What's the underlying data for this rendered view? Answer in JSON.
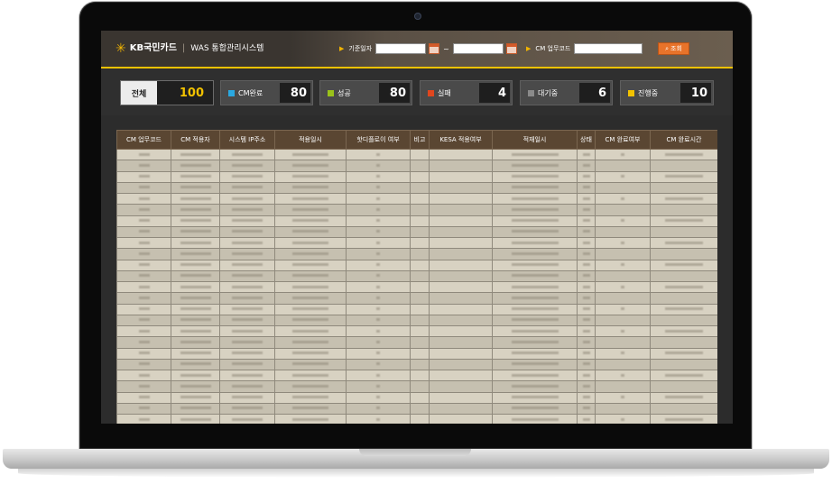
{
  "app": {
    "brand": "KB국민카드",
    "system_title": "WAS 통합관리시스템"
  },
  "filters": {
    "base_date_label": "기준일자",
    "cm_code_label": "CM 업무코드",
    "range_separator": "~",
    "search_label": "조회"
  },
  "summary": [
    {
      "label": "전체",
      "value": "100",
      "color": "#f2c200"
    },
    {
      "label": "CM완료",
      "value": "80",
      "color": "#2aa8e0"
    },
    {
      "label": "성공",
      "value": "80",
      "color": "#9ac21a"
    },
    {
      "label": "실패",
      "value": "4",
      "color": "#e0461e"
    },
    {
      "label": "대기중",
      "value": "6",
      "color": "#8a8a8a"
    },
    {
      "label": "진행중",
      "value": "10",
      "color": "#f2c200"
    }
  ],
  "table": {
    "headers": [
      "CM 업무코드",
      "CM 적용자",
      "시스템 IP주소",
      "적용일시",
      "핫디플로이 여부",
      "비고",
      "KESA 적용여부",
      "적재일시",
      "상태",
      "CM 완료여부",
      "CM 완료시간"
    ]
  },
  "colors": {
    "accent": "#f2c200",
    "header_bg": "#5a4632",
    "search_button": "#e8732a"
  }
}
